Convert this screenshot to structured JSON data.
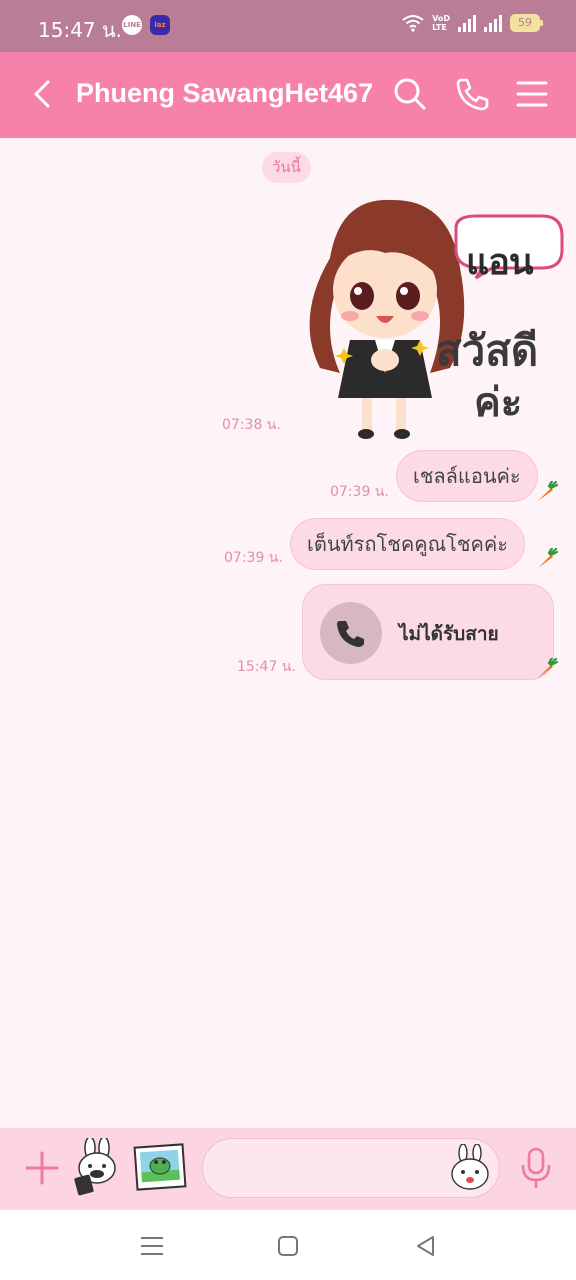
{
  "status_bar": {
    "time": "15:47 น.",
    "app_icons": [
      "line-icon",
      "lazada-icon"
    ],
    "line_icon_text": "LINE",
    "lazada_icon_text": "laz",
    "volte_top": "VoD",
    "volte_bottom": "LTE",
    "battery": "59"
  },
  "header": {
    "title": "Phueng SawangHet467",
    "icons": [
      "back-chevron-icon",
      "search-icon",
      "phone-icon",
      "menu-icon"
    ],
    "background": "#f682ab"
  },
  "chat": {
    "date_label": "วันนี้",
    "messages": [
      {
        "type": "sticker",
        "time": "07:38 น.",
        "sticker_text": [
          "แอน",
          "สวัสดี",
          "ค่ะ"
        ]
      },
      {
        "type": "text",
        "time": "07:39 น.",
        "text": "เชลล์แอนค่ะ"
      },
      {
        "type": "text",
        "time": "07:39 น.",
        "text": "เต็นท์รถโชคคูณโชคค่ะ"
      },
      {
        "type": "call",
        "time": "15:47 น.",
        "text": "ไม่ได้รับสาย"
      }
    ],
    "bubble_color": "#fcdbe6",
    "timestamp_color": "#e68cb0"
  },
  "input_bar": {
    "placeholder": "",
    "icons": [
      "plus-icon",
      "bunny-sticker-icon",
      "frog-photo-icon",
      "bunny-emoji-icon",
      "microphone-icon"
    ]
  },
  "nav_bar": {
    "icons": [
      "recent-apps-icon",
      "home-icon",
      "back-icon"
    ]
  }
}
